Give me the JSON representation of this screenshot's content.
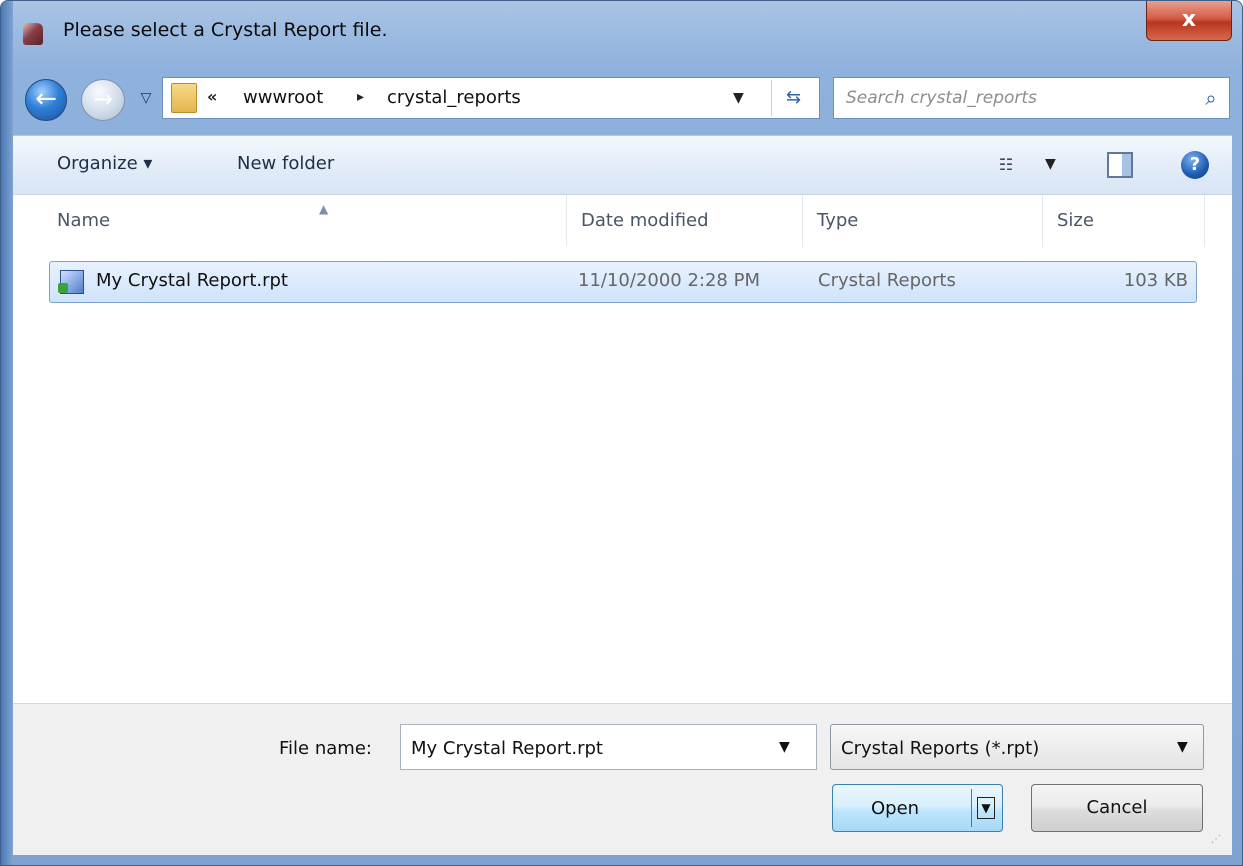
{
  "window": {
    "title": "Please select a Crystal Report file.",
    "close_label": "x"
  },
  "address": {
    "overflow": "«",
    "breadcrumbs": [
      "wwwroot",
      "crystal_reports"
    ],
    "separator": "▸"
  },
  "search": {
    "placeholder": "Search crystal_reports"
  },
  "toolbar": {
    "organize_label": "Organize ▾",
    "new_folder_label": "New folder"
  },
  "columns": [
    "Name",
    "Date modified",
    "Type",
    "Size"
  ],
  "files": [
    {
      "name": "My Crystal Report.rpt",
      "date_modified": "11/10/2000 2:28 PM",
      "type": "Crystal Reports",
      "size": "103 KB",
      "selected": true
    }
  ],
  "footer": {
    "file_name_label": "File name:",
    "file_name_value": "My Crystal Report.rpt",
    "file_type_value": "Crystal Reports (*.rpt)",
    "open_label": "Open",
    "cancel_label": "Cancel"
  },
  "colors": {
    "selection": "#cfe3fc",
    "accent": "#3c7fb1",
    "close_button": "#c8442e"
  },
  "icons": {
    "app": "crystal-reports-app-icon",
    "back": "back-arrow-icon",
    "forward": "forward-arrow-icon",
    "folder": "folder-icon",
    "refresh": "refresh-icon",
    "search": "search-icon",
    "view": "view-options-icon",
    "preview": "preview-pane-icon",
    "help": "help-icon",
    "file": "crystal-report-file-icon"
  }
}
